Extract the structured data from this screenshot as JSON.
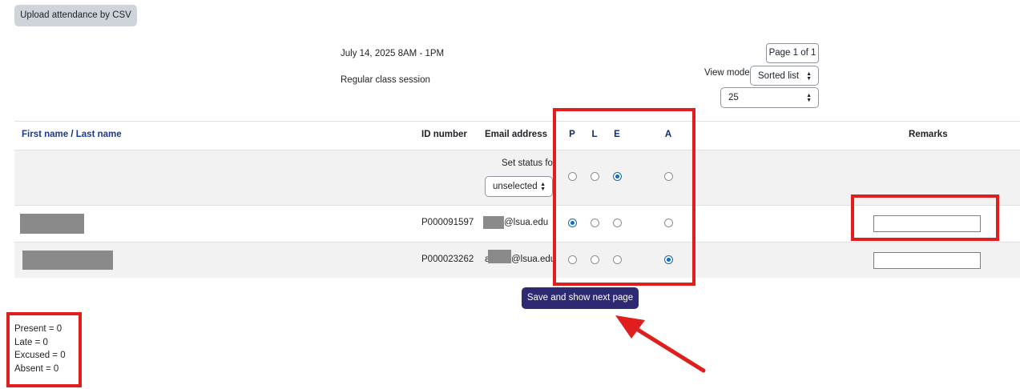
{
  "toolbar": {
    "upload_label": "Upload attendance by CSV"
  },
  "session": {
    "date": "July 14, 2025 8AM - 1PM",
    "description": "Regular class session"
  },
  "pager": {
    "page_label": "Page 1 of 1",
    "view_mode_label": "View mode",
    "view_mode_value": "Sorted list",
    "per_page_value": "25"
  },
  "table": {
    "headers": {
      "first_name": "First name",
      "separator": " / ",
      "last_name": "Last name",
      "id_number": "ID number",
      "email": "Email address",
      "p": "P",
      "l": "L",
      "e": "E",
      "a": "A",
      "remarks": "Remarks"
    },
    "set_status": {
      "label": "Set status for",
      "value": "unselected",
      "selected": "E"
    },
    "rows": [
      {
        "id": "P000091597",
        "email": "@lsua.edu",
        "status": "P"
      },
      {
        "id": "P000023262",
        "email": "@lsua.edu",
        "email_prefix": "a",
        "status": "A"
      }
    ]
  },
  "save_label": "Save and show next page",
  "summary": {
    "present": "Present = 0",
    "late": "Late = 0",
    "excused": "Excused = 0",
    "absent": "Absent = 0"
  },
  "colors": {
    "accent": "#2d2a73",
    "annotation": "#e01e1e",
    "radio": "#0f6cbf"
  }
}
